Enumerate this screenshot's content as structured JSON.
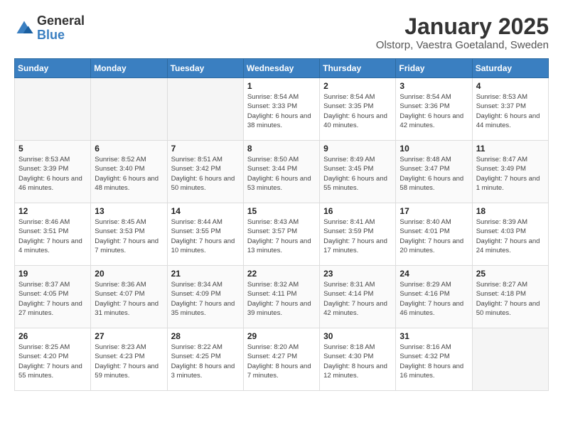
{
  "logo": {
    "general": "General",
    "blue": "Blue"
  },
  "title": "January 2025",
  "location": "Olstorp, Vaestra Goetaland, Sweden",
  "days_of_week": [
    "Sunday",
    "Monday",
    "Tuesday",
    "Wednesday",
    "Thursday",
    "Friday",
    "Saturday"
  ],
  "weeks": [
    [
      {
        "day": "",
        "empty": true
      },
      {
        "day": "",
        "empty": true
      },
      {
        "day": "",
        "empty": true
      },
      {
        "day": "1",
        "sunrise": "8:54 AM",
        "sunset": "3:33 PM",
        "daylight": "6 hours and 38 minutes."
      },
      {
        "day": "2",
        "sunrise": "8:54 AM",
        "sunset": "3:35 PM",
        "daylight": "6 hours and 40 minutes."
      },
      {
        "day": "3",
        "sunrise": "8:54 AM",
        "sunset": "3:36 PM",
        "daylight": "6 hours and 42 minutes."
      },
      {
        "day": "4",
        "sunrise": "8:53 AM",
        "sunset": "3:37 PM",
        "daylight": "6 hours and 44 minutes."
      }
    ],
    [
      {
        "day": "5",
        "sunrise": "8:53 AM",
        "sunset": "3:39 PM",
        "daylight": "6 hours and 46 minutes."
      },
      {
        "day": "6",
        "sunrise": "8:52 AM",
        "sunset": "3:40 PM",
        "daylight": "6 hours and 48 minutes."
      },
      {
        "day": "7",
        "sunrise": "8:51 AM",
        "sunset": "3:42 PM",
        "daylight": "6 hours and 50 minutes."
      },
      {
        "day": "8",
        "sunrise": "8:50 AM",
        "sunset": "3:44 PM",
        "daylight": "6 hours and 53 minutes."
      },
      {
        "day": "9",
        "sunrise": "8:49 AM",
        "sunset": "3:45 PM",
        "daylight": "6 hours and 55 minutes."
      },
      {
        "day": "10",
        "sunrise": "8:48 AM",
        "sunset": "3:47 PM",
        "daylight": "6 hours and 58 minutes."
      },
      {
        "day": "11",
        "sunrise": "8:47 AM",
        "sunset": "3:49 PM",
        "daylight": "7 hours and 1 minute."
      }
    ],
    [
      {
        "day": "12",
        "sunrise": "8:46 AM",
        "sunset": "3:51 PM",
        "daylight": "7 hours and 4 minutes."
      },
      {
        "day": "13",
        "sunrise": "8:45 AM",
        "sunset": "3:53 PM",
        "daylight": "7 hours and 7 minutes."
      },
      {
        "day": "14",
        "sunrise": "8:44 AM",
        "sunset": "3:55 PM",
        "daylight": "7 hours and 10 minutes."
      },
      {
        "day": "15",
        "sunrise": "8:43 AM",
        "sunset": "3:57 PM",
        "daylight": "7 hours and 13 minutes."
      },
      {
        "day": "16",
        "sunrise": "8:41 AM",
        "sunset": "3:59 PM",
        "daylight": "7 hours and 17 minutes."
      },
      {
        "day": "17",
        "sunrise": "8:40 AM",
        "sunset": "4:01 PM",
        "daylight": "7 hours and 20 minutes."
      },
      {
        "day": "18",
        "sunrise": "8:39 AM",
        "sunset": "4:03 PM",
        "daylight": "7 hours and 24 minutes."
      }
    ],
    [
      {
        "day": "19",
        "sunrise": "8:37 AM",
        "sunset": "4:05 PM",
        "daylight": "7 hours and 27 minutes."
      },
      {
        "day": "20",
        "sunrise": "8:36 AM",
        "sunset": "4:07 PM",
        "daylight": "7 hours and 31 minutes."
      },
      {
        "day": "21",
        "sunrise": "8:34 AM",
        "sunset": "4:09 PM",
        "daylight": "7 hours and 35 minutes."
      },
      {
        "day": "22",
        "sunrise": "8:32 AM",
        "sunset": "4:11 PM",
        "daylight": "7 hours and 39 minutes."
      },
      {
        "day": "23",
        "sunrise": "8:31 AM",
        "sunset": "4:14 PM",
        "daylight": "7 hours and 42 minutes."
      },
      {
        "day": "24",
        "sunrise": "8:29 AM",
        "sunset": "4:16 PM",
        "daylight": "7 hours and 46 minutes."
      },
      {
        "day": "25",
        "sunrise": "8:27 AM",
        "sunset": "4:18 PM",
        "daylight": "7 hours and 50 minutes."
      }
    ],
    [
      {
        "day": "26",
        "sunrise": "8:25 AM",
        "sunset": "4:20 PM",
        "daylight": "7 hours and 55 minutes."
      },
      {
        "day": "27",
        "sunrise": "8:23 AM",
        "sunset": "4:23 PM",
        "daylight": "7 hours and 59 minutes."
      },
      {
        "day": "28",
        "sunrise": "8:22 AM",
        "sunset": "4:25 PM",
        "daylight": "8 hours and 3 minutes."
      },
      {
        "day": "29",
        "sunrise": "8:20 AM",
        "sunset": "4:27 PM",
        "daylight": "8 hours and 7 minutes."
      },
      {
        "day": "30",
        "sunrise": "8:18 AM",
        "sunset": "4:30 PM",
        "daylight": "8 hours and 12 minutes."
      },
      {
        "day": "31",
        "sunrise": "8:16 AM",
        "sunset": "4:32 PM",
        "daylight": "8 hours and 16 minutes."
      },
      {
        "day": "",
        "empty": true
      }
    ]
  ],
  "labels": {
    "sunrise": "Sunrise:",
    "sunset": "Sunset:",
    "daylight": "Daylight:"
  }
}
